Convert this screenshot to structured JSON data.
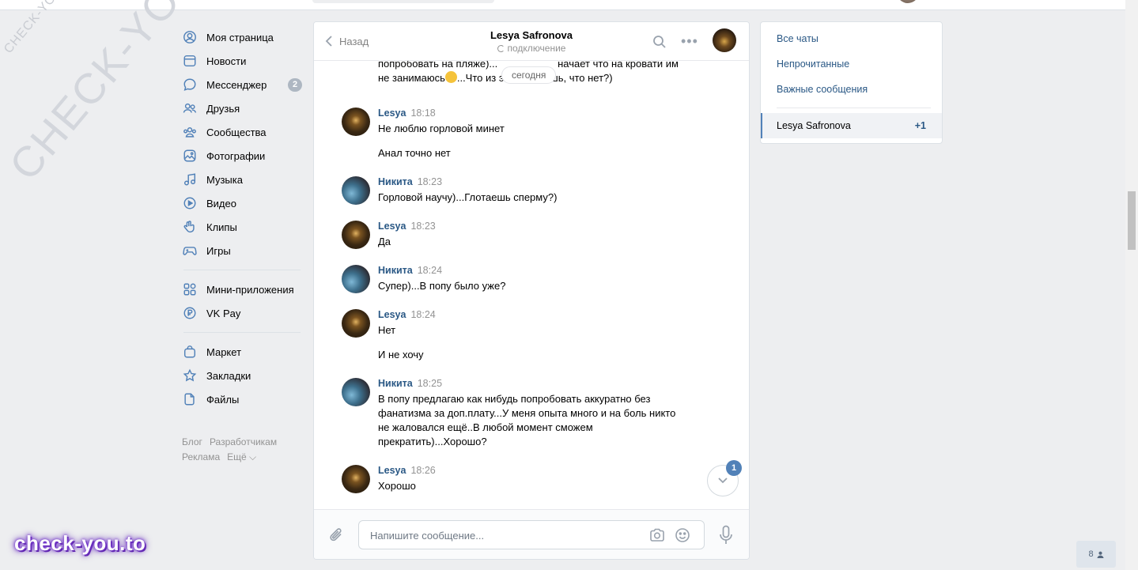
{
  "nav": {
    "items": [
      {
        "label": "Моя страница",
        "icon": "user-circle-icon"
      },
      {
        "label": "Новости",
        "icon": "newspaper-icon"
      },
      {
        "label": "Мессенджер",
        "icon": "message-icon",
        "badge": "2"
      },
      {
        "label": "Друзья",
        "icon": "friends-icon"
      },
      {
        "label": "Сообщества",
        "icon": "communities-icon"
      },
      {
        "label": "Фотографии",
        "icon": "photo-icon"
      },
      {
        "label": "Музыка",
        "icon": "music-icon"
      },
      {
        "label": "Видео",
        "icon": "video-icon"
      },
      {
        "label": "Клипы",
        "icon": "clips-icon"
      },
      {
        "label": "Игры",
        "icon": "gamepad-icon"
      }
    ],
    "items2": [
      {
        "label": "Мини-приложения",
        "icon": "apps-icon"
      },
      {
        "label": "VK Pay",
        "icon": "vkpay-icon"
      }
    ],
    "items3": [
      {
        "label": "Маркет",
        "icon": "bag-icon"
      },
      {
        "label": "Закладки",
        "icon": "star-icon"
      },
      {
        "label": "Файлы",
        "icon": "file-icon"
      }
    ],
    "footer": {
      "blog": "Блог",
      "developers": "Разработчикам",
      "ads": "Реклама",
      "more": "Ещё ⌵"
    }
  },
  "chat": {
    "back_label": "Назад",
    "title": "Lesya Safronova",
    "status": "подключение",
    "date_pill": "сегодня",
    "partial_message": {
      "line1": "попробовать на пляже)...",
      "line1b": "начает что на кровати им",
      "line2a": "не занимаюсь",
      "line2b": "...Что из этого умеешь, что нет?)"
    },
    "messages": [
      {
        "author": "Lesya",
        "time": "18:18",
        "avatar": "lesya",
        "lines": [
          "Не люблю горловой минет",
          "Анал точно нет"
        ]
      },
      {
        "author": "Никита",
        "time": "18:23",
        "avatar": "nikita",
        "lines": [
          "Горловой научу)...Глотаешь сперму?)"
        ]
      },
      {
        "author": "Lesya",
        "time": "18:23",
        "avatar": "lesya",
        "lines": [
          "Да"
        ]
      },
      {
        "author": "Никита",
        "time": "18:24",
        "avatar": "nikita",
        "lines": [
          "Супер)...В попу было уже?"
        ]
      },
      {
        "author": "Lesya",
        "time": "18:24",
        "avatar": "lesya",
        "lines": [
          "Нет",
          "И не хочу"
        ]
      },
      {
        "author": "Никита",
        "time": "18:25",
        "avatar": "nikita",
        "lines": [
          "В попу предлагаю как нибудь попробовать аккуратно без фанатизма за доп.плату...У меня опыта много и на боль никто не жаловался ещё..В любой момент сможем прекратить)...Хорошо?"
        ]
      },
      {
        "author": "Lesya",
        "time": "18:26",
        "avatar": "lesya",
        "lines": [
          "Хорошо"
        ]
      }
    ],
    "unread_badge": "1",
    "composer": {
      "placeholder": "Напишите сообщение...",
      "value": ""
    }
  },
  "right_panel": {
    "all_chats": "Все чаты",
    "unread": "Непрочитанные",
    "important": "Важные сообщения",
    "active_chat": {
      "name": "Lesya Safronova",
      "count": "+1"
    }
  },
  "watermark": {
    "small": "CHECK-YOU.ME",
    "big": "CHECK-YOU.ME",
    "brand": "check-you.to"
  },
  "online_users": "8",
  "colors": {
    "accent": "#5181b8",
    "link": "#2a5885",
    "background": "#edeef0",
    "badge_gray": "#aeb7c2"
  }
}
